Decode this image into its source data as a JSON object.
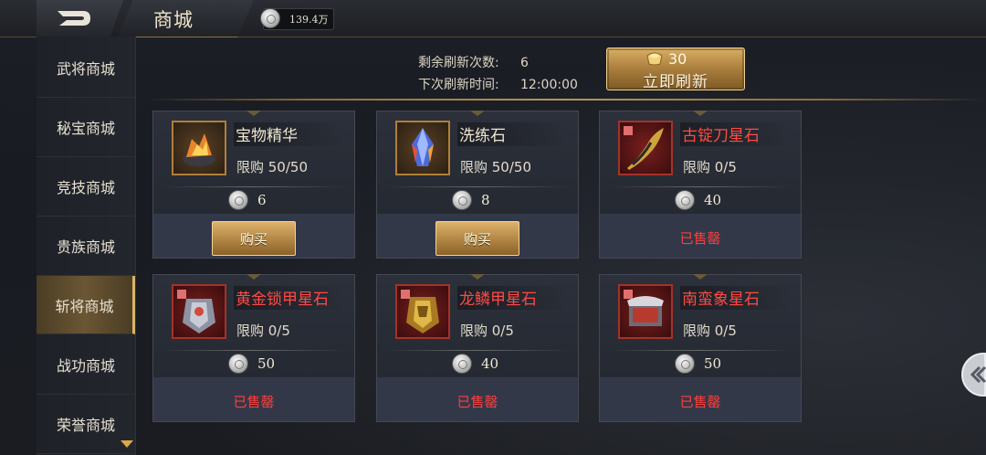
{
  "header": {
    "title": "商城",
    "currency_amount": "139.4万"
  },
  "sidebar": {
    "items": [
      {
        "label": "武将商城"
      },
      {
        "label": "秘宝商城"
      },
      {
        "label": "竞技商城"
      },
      {
        "label": "贵族商城"
      },
      {
        "label": "斩将商城",
        "active": true
      },
      {
        "label": "战功商城"
      },
      {
        "label": "荣誉商城"
      }
    ]
  },
  "refresh": {
    "remaining_label": "剩余刷新次数:",
    "remaining_value": "6",
    "next_label": "下次刷新时间:",
    "next_value": "12:00:00",
    "cost": "30",
    "button_label": "立即刷新"
  },
  "cards": [
    {
      "name": "宝物精华",
      "name_color": "normal",
      "limit": "限购 50/50",
      "price": "6",
      "action": "购买",
      "sold": false,
      "icon": "treasure-essence-icon"
    },
    {
      "name": "洗练石",
      "name_color": "normal",
      "limit": "限购 50/50",
      "price": "8",
      "action": "购买",
      "sold": false,
      "icon": "refining-stone-icon"
    },
    {
      "name": "古锭刀星石",
      "name_color": "red",
      "limit": "限购 0/5",
      "price": "40",
      "action": "已售罄",
      "sold": true,
      "icon": "blade-star-stone-icon"
    },
    {
      "name": "黄金锁甲星石",
      "name_color": "red",
      "limit": "限购 0/5",
      "price": "50",
      "action": "已售罄",
      "sold": true,
      "icon": "golden-armor-star-stone-icon"
    },
    {
      "name": "龙鳞甲星石",
      "name_color": "red",
      "limit": "限购 0/5",
      "price": "40",
      "action": "已售罄",
      "sold": true,
      "icon": "dragon-scale-armor-star-stone-icon"
    },
    {
      "name": "南蛮象星石",
      "name_color": "red",
      "limit": "限购 0/5",
      "price": "50",
      "action": "已售罄",
      "sold": true,
      "icon": "nanman-elephant-star-stone-icon"
    }
  ],
  "colors": {
    "accent_gold": "#d8ad64",
    "sold_red": "#ff3e3a",
    "active_tab": "#6b5634"
  }
}
